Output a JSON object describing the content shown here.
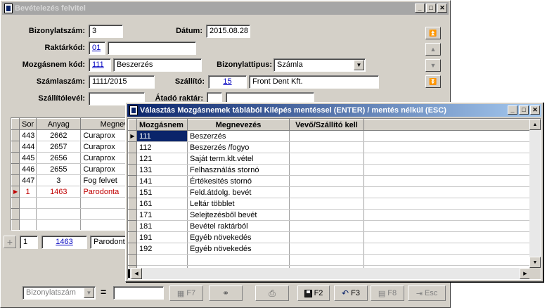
{
  "main_window": {
    "title": "Bevételezés felvitel",
    "fields": {
      "bizonylatszam_label": "Bizonylatszám:",
      "bizonylatszam_value": "3",
      "datum_label": "Dátum:",
      "datum_value": "2015.08.28",
      "raktarkod_label": "Raktárkód:",
      "raktarkod_value": "01",
      "mozgasnem_label": "Mozgásnem kód:",
      "mozgasnem_code": "111",
      "mozgasnem_name": "Beszerzés",
      "bizonylattipus_label": "Bizonylattipus:",
      "bizonylattipus_value": "Számla",
      "szamlaszam_label": "Számlaszám:",
      "szamlaszam_value": "1111/2015",
      "szallito_label": "Szállító:",
      "szallito_code": "15",
      "szallito_name": "Front Dent Kft.",
      "szallitolevel_label": "Szállítólevél:",
      "atado_label": "Átadó raktár:"
    },
    "grid": {
      "headers": [
        "Sor",
        "Anyag",
        "Megneve"
      ],
      "rows": [
        {
          "sor": "443",
          "anyag": "2662",
          "name": "Curaprox"
        },
        {
          "sor": "444",
          "anyag": "2657",
          "name": "Curaprox"
        },
        {
          "sor": "445",
          "anyag": "2656",
          "name": "Curaprox"
        },
        {
          "sor": "446",
          "anyag": "2655",
          "name": "Curaprox"
        },
        {
          "sor": "447",
          "anyag": "3",
          "name": "Fog felvet"
        },
        {
          "sor": "1",
          "anyag": "1463",
          "name": "Parodonta"
        }
      ]
    },
    "edit_row": {
      "sor": "1",
      "anyag": "1463",
      "name": "Parodonte"
    },
    "footer": {
      "filter_select": "Bizonylatszám",
      "equals": "=",
      "btn_f7": "F7",
      "btn_f2": "F2",
      "btn_f3": "F3",
      "btn_f8": "F8",
      "btn_esc": "Esc"
    }
  },
  "popup": {
    "title": "Választás Mozgásnemek táblából  Kilépés mentéssel (ENTER) / mentés nélkül (ESC)",
    "headers": [
      "Mozgásnem",
      "Megnevezés",
      "Vevő/Szállító kell"
    ],
    "rows": [
      {
        "code": "111",
        "name": "Beszerzés"
      },
      {
        "code": "112",
        "name": "Beszerzés /fogyo"
      },
      {
        "code": "121",
        "name": "Saját term.klt.vétel"
      },
      {
        "code": "131",
        "name": "Felhasználás stornó"
      },
      {
        "code": "141",
        "name": "Értékesités stornó"
      },
      {
        "code": "151",
        "name": "Feld.átdolg. bevét"
      },
      {
        "code": "161",
        "name": "Leltár többlet"
      },
      {
        "code": "171",
        "name": "Selejtezésből bevét"
      },
      {
        "code": "181",
        "name": "Bevétel raktárból"
      },
      {
        "code": "191",
        "name": "Egyéb növekedés"
      },
      {
        "code": "192",
        "name": "Egyéb növekedés"
      }
    ]
  }
}
